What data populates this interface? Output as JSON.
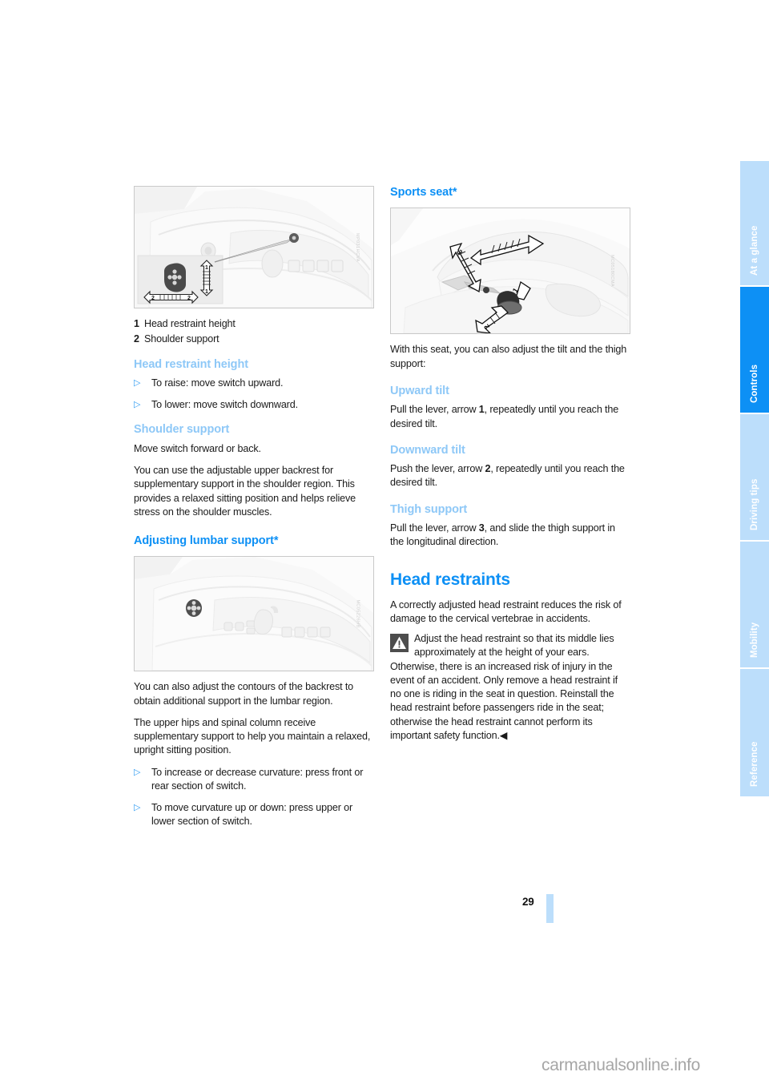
{
  "document": {
    "page_number": "29",
    "watermark": "carmanualsonline.info"
  },
  "sidebar": {
    "tabs": [
      {
        "label": "At a glance",
        "active": false
      },
      {
        "label": "Controls",
        "active": true
      },
      {
        "label": "Driving tips",
        "active": false
      },
      {
        "label": "Mobility",
        "active": false
      },
      {
        "label": "Reference",
        "active": false
      }
    ],
    "active_color": "#0d90f5",
    "inactive_color": "#bcdefb"
  },
  "left_column": {
    "figure_seat_switch": {
      "alt": "Seat control switch panel with head restraint height and shoulder support callouts",
      "code": "MP031HCVA"
    },
    "legend": [
      {
        "num": "1",
        "text": "Head restraint height"
      },
      {
        "num": "2",
        "text": "Shoulder support"
      }
    ],
    "head_restraint_height": {
      "heading": "Head restraint height",
      "bullets": [
        "To raise: move switch upward.",
        "To lower: move switch downward."
      ]
    },
    "shoulder_support": {
      "heading": "Shoulder support",
      "paragraphs": [
        "Move switch forward or back.",
        "You can use the adjustable upper backrest for supplementary support in the shoulder region. This provides a relaxed sitting position and helps relieve stress on the shoulder muscles."
      ]
    },
    "lumbar_support": {
      "heading": "Adjusting lumbar support*",
      "figure": {
        "alt": "Seat side panel showing lumbar support switch",
        "code": "MC05226HB"
      },
      "paragraphs": [
        "You can also adjust the contours of the backrest to obtain additional support in the lumbar region.",
        "The upper hips and spinal column receive supplementary support to help you maintain a relaxed, upright sitting position."
      ],
      "bullets": [
        "To increase or decrease curvature: press front or rear section of switch.",
        "To move curvature up or down: press upper or lower section of switch."
      ]
    }
  },
  "right_column": {
    "sports_seat": {
      "heading": "Sports seat*",
      "figure": {
        "alt": "Sports seat with arrows 1, 2 and 3 indicating tilt and thigh support adjustment",
        "code": "MC05180CMA"
      },
      "intro": "With this seat, you can also adjust the tilt and the thigh support:",
      "upward_tilt": {
        "heading": "Upward tilt",
        "text_before": "Pull the lever, arrow ",
        "bold": "1",
        "text_after": ", repeatedly until you reach the desired tilt."
      },
      "downward_tilt": {
        "heading": "Downward tilt",
        "text_before": "Push the lever, arrow ",
        "bold": "2",
        "text_after": ", repeatedly until you reach the desired tilt."
      },
      "thigh_support": {
        "heading": "Thigh support",
        "text_before": "Pull the lever, arrow ",
        "bold": "3",
        "text_after": ", and slide the thigh support in the longitudinal direction."
      }
    },
    "head_restraints": {
      "heading": "Head restraints",
      "intro": "A correctly adjusted head restraint reduces the risk of damage to the cervical vertebrae in accidents.",
      "warning": "Adjust the head restraint so that its middle lies approximately at the height of your ears. Otherwise, there is an increased risk of injury in the event of an accident. Only remove a head restraint if no one is riding in the seat in question. Reinstall the head restraint before passengers ride in the seat; otherwise the head restraint cannot perform its important safety function.◀"
    }
  },
  "icons": {
    "bullet_marker": "▷"
  }
}
